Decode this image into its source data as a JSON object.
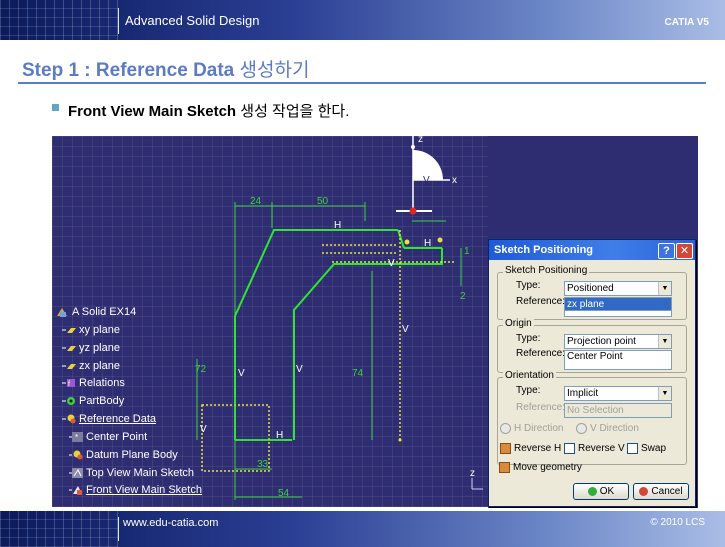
{
  "header": {
    "title": "Advanced Solid Design",
    "right": "CATIA V5"
  },
  "step": {
    "prefix": "Step 1 : Reference Data",
    "suffix": "생성하기"
  },
  "subtitle": {
    "bold": "Front View Main Sketch",
    "rest": "생성 작업을 한다."
  },
  "sketch": {
    "dims": {
      "d24": "24",
      "d50": "50",
      "d72": "72",
      "d74": "74",
      "d33": "33",
      "d54": "54",
      "d2": "2",
      "d1": "1"
    },
    "axis_labels": {
      "z": "z",
      "x": "x",
      "v": "V",
      "h": "H",
      "y": "y"
    },
    "constraint_marks": [
      "H",
      "V",
      "V",
      "V",
      "V",
      "H"
    ]
  },
  "tree": {
    "items": [
      {
        "label": "A Solid EX14",
        "icon": "part-icon"
      },
      {
        "label": "xy plane",
        "icon": "plane-icon"
      },
      {
        "label": "yz plane",
        "icon": "plane-icon"
      },
      {
        "label": "zx plane",
        "icon": "plane-icon"
      },
      {
        "label": "Relations",
        "icon": "relations-icon"
      },
      {
        "label": "PartBody",
        "icon": "partbody-icon"
      },
      {
        "label": "Reference Data",
        "icon": "geoset-icon"
      },
      {
        "label": "Center Point",
        "icon": "point-icon"
      },
      {
        "label": "Datum Plane Body",
        "icon": "geoset-icon"
      },
      {
        "label": "Top View Main Sketch",
        "icon": "sketch-icon"
      },
      {
        "label": "Front View Main Sketch",
        "icon": "sketch-icon"
      }
    ]
  },
  "dialog": {
    "title": "Sketch Positioning",
    "help": "?",
    "close": "✕",
    "positioning": {
      "group": "Sketch Positioning",
      "type_label": "Type:",
      "type_value": "Positioned",
      "ref_label": "Reference:",
      "ref_value": "zx plane"
    },
    "origin": {
      "group": "Origin",
      "type_label": "Type:",
      "type_value": "Projection point",
      "ref_label": "Reference:",
      "ref_value": "Center Point"
    },
    "orientation": {
      "group": "Orientation",
      "type_label": "Type:",
      "type_value": "Implicit",
      "ref_label": "Reference:",
      "ref_value": "No Selection",
      "h_dir": "H Direction",
      "v_dir": "V Direction",
      "reverse_h": "Reverse H",
      "reverse_v": "Reverse V",
      "swap": "Swap"
    },
    "move_geometry": "Move geometry",
    "ok": "OK",
    "cancel": "Cancel"
  },
  "footer": {
    "url": "www.edu-catia.com",
    "copyright": "© 2010 LCS"
  }
}
